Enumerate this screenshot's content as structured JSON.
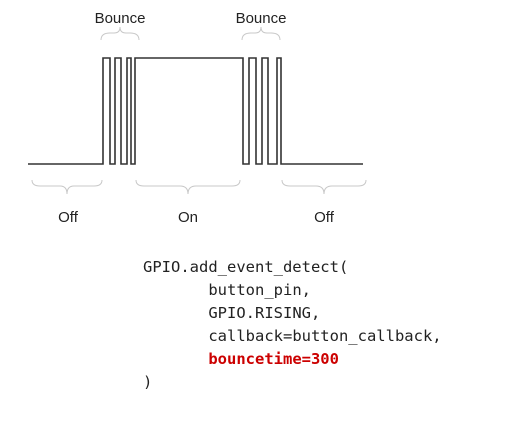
{
  "diagram": {
    "labels": {
      "bounce_left": "Bounce",
      "bounce_right": "Bounce",
      "off_left": "Off",
      "on": "On",
      "off_right": "Off"
    }
  },
  "code": {
    "line1": "GPIO.add_event_detect(",
    "line2": "button_pin,",
    "line3": "GPIO.RISING,",
    "line4": "callback=button_callback,",
    "line5": "bouncetime=300",
    "line6": ")",
    "highlight_color": "#cc0000"
  }
}
